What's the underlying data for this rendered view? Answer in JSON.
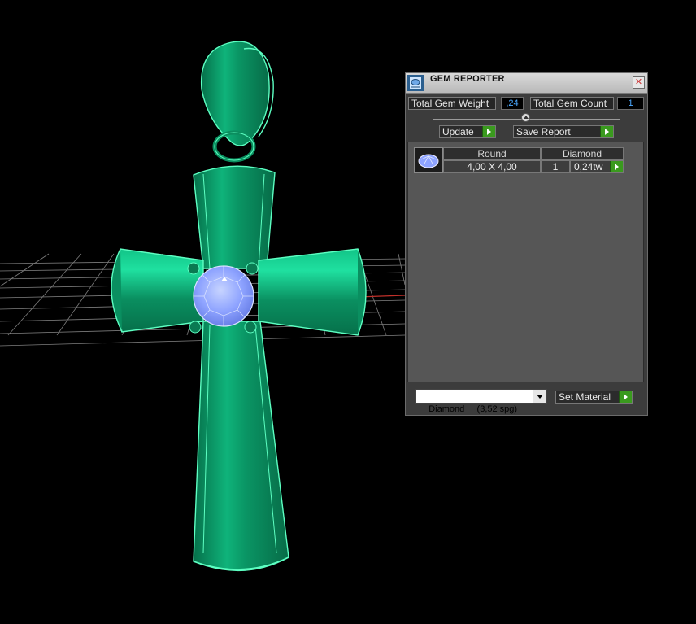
{
  "window": {
    "title": "GEM REPORTER"
  },
  "summary": {
    "total_weight_label": "Total Gem Weight",
    "total_weight_value": ",24",
    "total_count_label": "Total Gem Count",
    "total_count_value": "1"
  },
  "toolbar": {
    "update_label": "Update",
    "save_report_label": "Save Report"
  },
  "gem_table": {
    "rows": [
      {
        "shape": "Round",
        "size": "4,00 X 4,00",
        "material": "Diamond",
        "count": "1",
        "weight": "0,24tw"
      }
    ]
  },
  "footer": {
    "material_select_value": "Diamond     (3,52 spg)",
    "set_material_label": "Set Material"
  },
  "colors": {
    "metal": "#0e9a6a",
    "gem": "#8fa6ff",
    "grid": "#9a9a9a",
    "panel": "#3c3c3c"
  },
  "icons": [
    "gem-reporter-app-icon",
    "close-icon",
    "slider-knob",
    "play-arrow-icon",
    "gem-thumbnail",
    "dropdown-arrow-icon"
  ]
}
